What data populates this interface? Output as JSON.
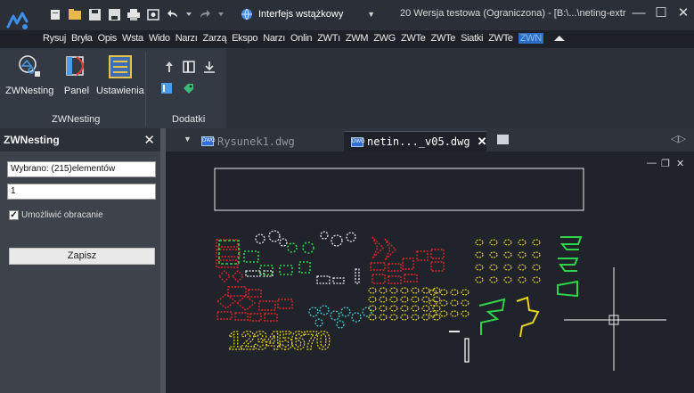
{
  "titlebar": {
    "workspace": "Interfejs wstążkowy",
    "title": "20 Wersja testowa (Ograniczona) - [B:\\...\\neting-extr",
    "minimize": "—",
    "maximize": "☐",
    "close": "✕"
  },
  "menu": {
    "items": [
      "Rysuj",
      "Bryła",
      "Opis",
      "Wsta",
      "Wido",
      "Narzı",
      "Zarzą",
      "Ekspo",
      "Narzı",
      "Onlin",
      "ZWTı",
      "ZWM",
      "ZWG",
      "ZWTe",
      "ZWTe",
      "Siatki",
      "ZWTe",
      "ZWN"
    ]
  },
  "ribbon": {
    "buttons": [
      "ZWNesting",
      "Panel",
      "Ustawienia"
    ],
    "panels": [
      "ZWNesting",
      "Dodatki"
    ]
  },
  "left_panel": {
    "title": "ZWNesting",
    "close": "✕",
    "selected_value": "Wybrano: (215)elementów",
    "count_value": "1",
    "rotate_label": "Umożliwić obracanie",
    "rotate_checked": "✓",
    "save_label": "Zapisz"
  },
  "tabs": {
    "tab1": "Rysunek1.dwg",
    "tab2": "netin..._v05.dwg",
    "tab_close": "✕",
    "file_icon_text": "DWG"
  },
  "canvas": {
    "minimize": "—",
    "restore": "❐",
    "close": "✕",
    "digits": "12345670",
    "colors": {
      "background": "#20232a",
      "red": "#d9262b",
      "yellow": "#e6d21f",
      "green": "#2fd34a",
      "cyan": "#3fcfd8",
      "white": "#e8e8e8",
      "crosshair": "#d0d0d0"
    }
  }
}
